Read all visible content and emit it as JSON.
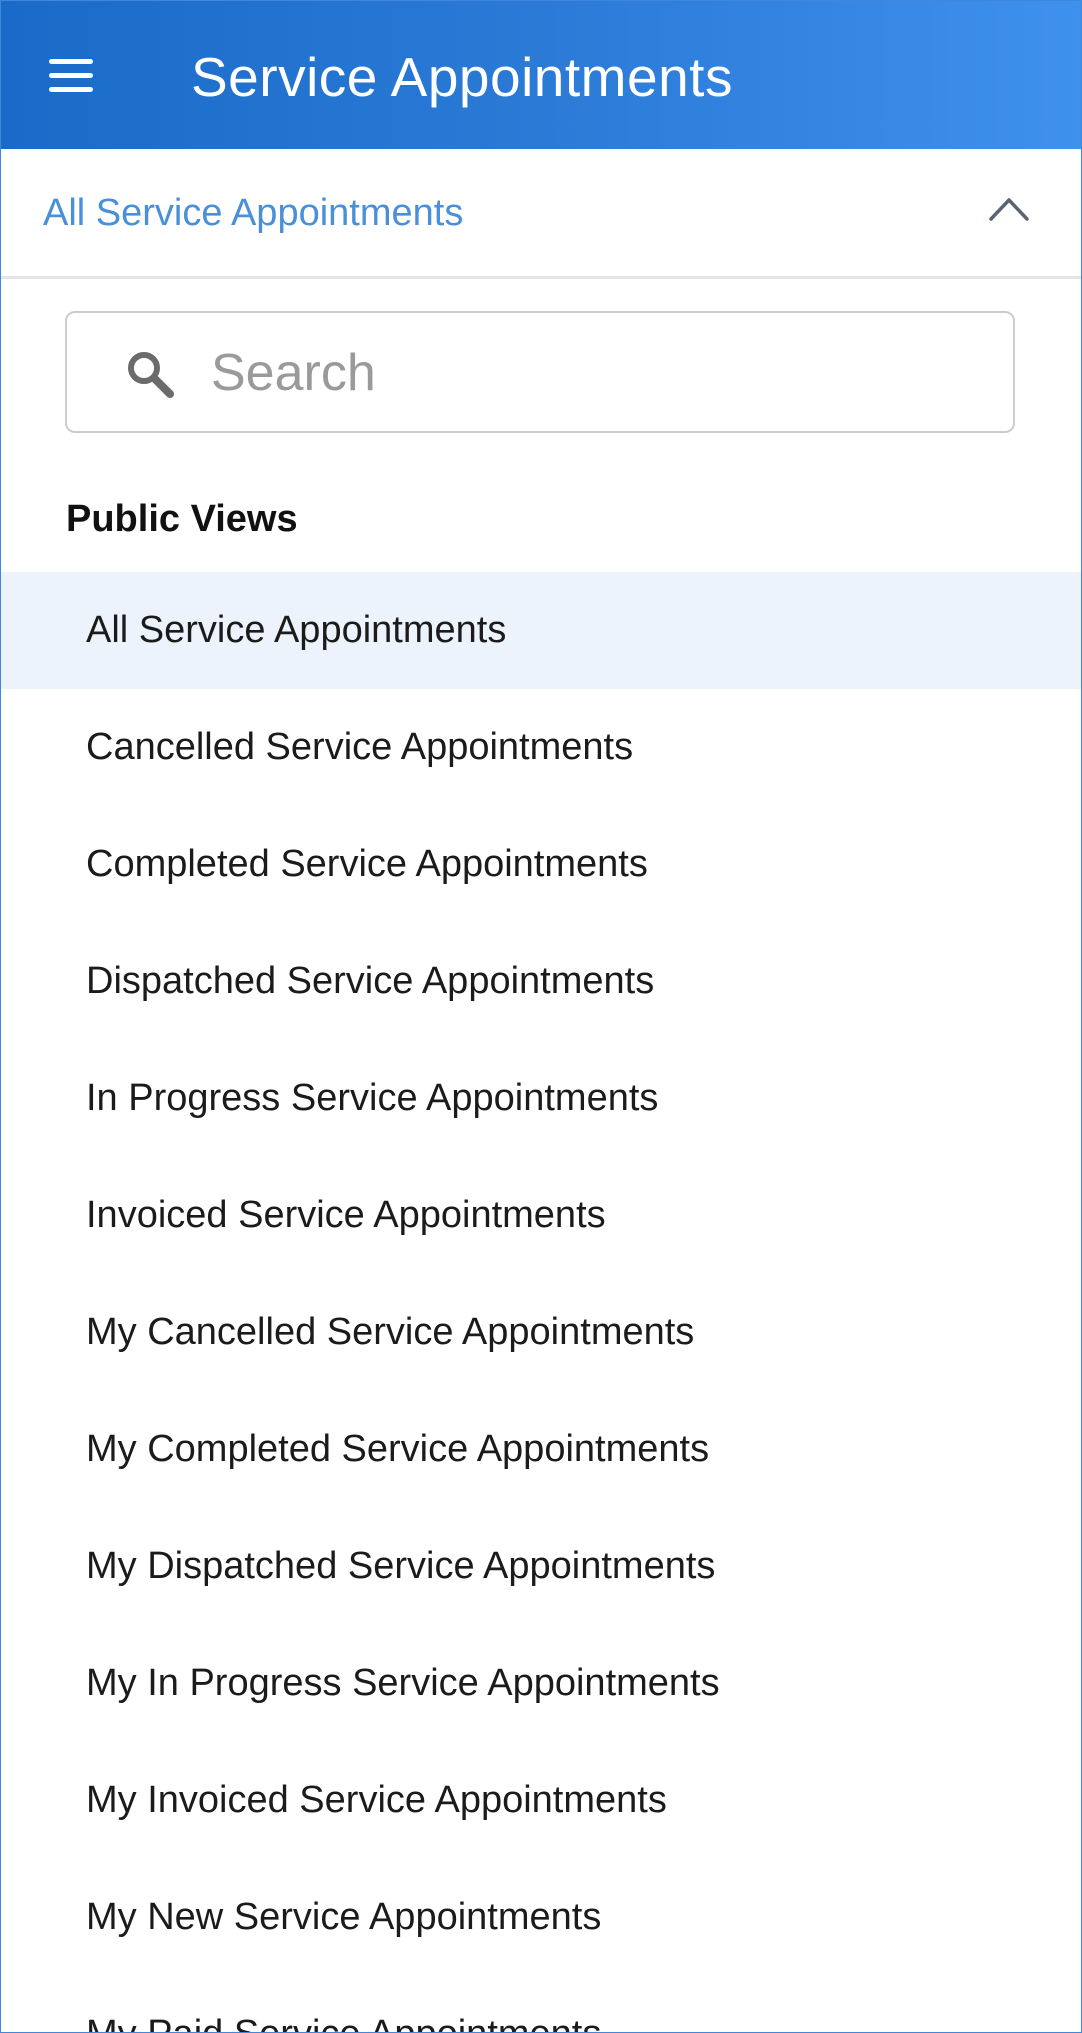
{
  "header": {
    "title": "Service Appointments",
    "menu_icon": "hamburger-menu-icon",
    "gradient_start": "#1a6ac9",
    "gradient_end": "#3f91ee"
  },
  "view_selector": {
    "label": "All Service Appointments",
    "icon": "chevron-up-icon",
    "label_color": "#4a90d9"
  },
  "search": {
    "placeholder": "Search",
    "value": "",
    "icon": "search-icon"
  },
  "section": {
    "heading": "Public Views"
  },
  "views": [
    {
      "label": "All Service Appointments",
      "selected": true
    },
    {
      "label": "Cancelled Service Appointments",
      "selected": false
    },
    {
      "label": "Completed Service Appointments",
      "selected": false
    },
    {
      "label": "Dispatched Service Appointments",
      "selected": false
    },
    {
      "label": "In Progress Service Appointments",
      "selected": false
    },
    {
      "label": "Invoiced Service Appointments",
      "selected": false
    },
    {
      "label": "My Cancelled Service Appointments",
      "selected": false
    },
    {
      "label": "My Completed Service Appointments",
      "selected": false
    },
    {
      "label": "My Dispatched Service Appointments",
      "selected": false
    },
    {
      "label": "My In Progress Service Appointments",
      "selected": false
    },
    {
      "label": "My Invoiced Service Appointments",
      "selected": false
    },
    {
      "label": "My New Service Appointments",
      "selected": false
    },
    {
      "label": "My Paid Service Appointments",
      "selected": false
    }
  ],
  "colors": {
    "selected_row_bg": "#edf3fd"
  }
}
